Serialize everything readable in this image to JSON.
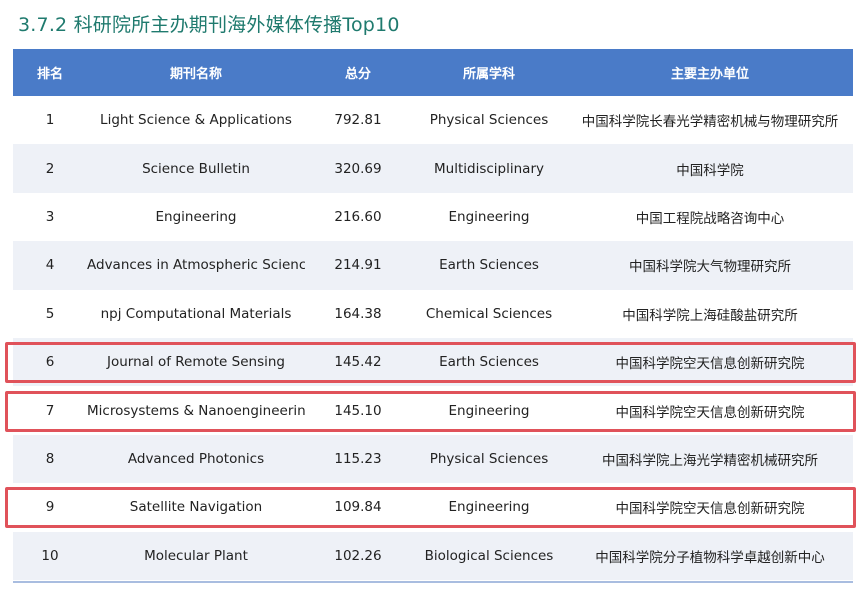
{
  "title": "3.7.2 科研院所主办期刊海外媒体传播Top10",
  "columns": [
    "排名",
    "期刊名称",
    "总分",
    "所属学科",
    "主要主办单位"
  ],
  "rows": [
    {
      "rank": "1",
      "name": "Light Science & Applications",
      "score": "792.81",
      "field": "Physical Sciences",
      "unit": "中国科学院长春光学精密机械与物理研究所"
    },
    {
      "rank": "2",
      "name": "Science Bulletin",
      "score": "320.69",
      "field": "Multidisciplinary",
      "unit": "中国科学院"
    },
    {
      "rank": "3",
      "name": "Engineering",
      "score": "216.60",
      "field": "Engineering",
      "unit": "中国工程院战略咨询中心"
    },
    {
      "rank": "4",
      "name": "Advances in Atmospheric Sciences",
      "score": "214.91",
      "field": "Earth Sciences",
      "unit": "中国科学院大气物理研究所"
    },
    {
      "rank": "5",
      "name": "npj Computational Materials",
      "score": "164.38",
      "field": "Chemical Sciences",
      "unit": "中国科学院上海硅酸盐研究所"
    },
    {
      "rank": "6",
      "name": "Journal of Remote Sensing",
      "score": "145.42",
      "field": "Earth Sciences",
      "unit": "中国科学院空天信息创新研究院"
    },
    {
      "rank": "7",
      "name": "Microsystems & Nanoengineering",
      "score": "145.10",
      "field": "Engineering",
      "unit": "中国科学院空天信息创新研究院"
    },
    {
      "rank": "8",
      "name": "Advanced Photonics",
      "score": "115.23",
      "field": "Physical Sciences",
      "unit": "中国科学院上海光学精密机械研究所"
    },
    {
      "rank": "9",
      "name": "Satellite Navigation",
      "score": "109.84",
      "field": "Engineering",
      "unit": "中国科学院空天信息创新研究院"
    },
    {
      "rank": "10",
      "name": "Molecular Plant",
      "score": "102.26",
      "field": "Biological Sciences",
      "unit": "中国科学院分子植物科学卓越创新中心"
    }
  ],
  "highlighted_ranks": [
    "6",
    "7",
    "9"
  ],
  "colors": {
    "header_bg": "#4a7bc8",
    "stripe_bg": "#eef1f7",
    "title_text": "#1f7a6e",
    "highlight_border": "#e0525a"
  }
}
